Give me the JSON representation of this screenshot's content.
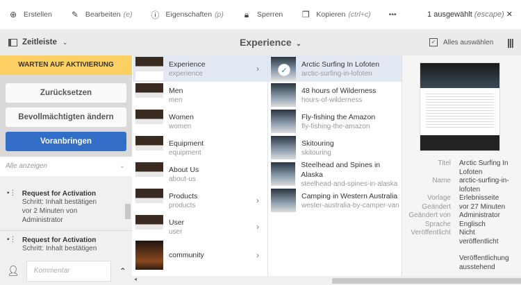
{
  "toolbar": {
    "create": "Erstellen",
    "edit": "Bearbeiten",
    "edit_key": "(e)",
    "props": "Eigenschaften",
    "props_key": "(p)",
    "lock": "Sperren",
    "copy": "Kopieren",
    "copy_key": "(ctrl+c)",
    "more": "•••",
    "selected": "1 ausgewählt",
    "selected_key": "(escape)",
    "close": "✕"
  },
  "header": {
    "rail": "Zeitleiste",
    "title": "Experience",
    "select_all": "Alles auswählen"
  },
  "left": {
    "banner": "WARTEN AUF AKTIVIERUNG",
    "btn_reset": "Zurücksetzen",
    "btn_delegate": "Bevollmächtigten ändern",
    "btn_advance": "Voranbringen",
    "filter": "Alle anzeigen",
    "items": [
      {
        "title": "Request for Activation",
        "step": "Schritt: Inhalt bestätigen",
        "time": "vor 2 Minuten von Administrator"
      },
      {
        "title": "Request for Activation",
        "step": "Schritt: Inhalt bestätigen"
      }
    ],
    "comment_placeholder": "Kommentar"
  },
  "col1": [
    {
      "title": "Experience",
      "name": "experience"
    },
    {
      "title": "Men",
      "name": "men"
    },
    {
      "title": "Women",
      "name": "women"
    },
    {
      "title": "Equipment",
      "name": "equipment"
    },
    {
      "title": "About Us",
      "name": "about-us"
    },
    {
      "title": "Products",
      "name": "products"
    },
    {
      "title": "User",
      "name": "user"
    },
    {
      "title": "community",
      "name": ""
    }
  ],
  "col2": [
    {
      "title": "Arctic Surfing In Lofoten",
      "name": "arctic-surfing-in-lofoten"
    },
    {
      "title": "48 hours of Wilderness",
      "name": "hours-of-wilderness"
    },
    {
      "title": "Fly-fishing the Amazon",
      "name": "fly-fishing-the-amazon"
    },
    {
      "title": "Skitouring",
      "name": "skitouring"
    },
    {
      "title": "Steelhead and Spines in Alaska",
      "name": "steelhead-and-spines-in-alaska"
    },
    {
      "title": "Camping in Western Australia",
      "name": "wester-australia-by-camper-van"
    }
  ],
  "meta": [
    {
      "k": "Titel",
      "v": "Arctic Surfing In Lofoten"
    },
    {
      "k": "Name",
      "v": "arctic-surfing-in-lofoten"
    },
    {
      "k": "Vorlage",
      "v": "Erlebnisseite"
    },
    {
      "k": "Geändert",
      "v": "vor 27 Minuten"
    },
    {
      "k": "Geändert von",
      "v": "Administrator"
    },
    {
      "k": "Sprache",
      "v": "Englisch"
    },
    {
      "k": "Veröffentlicht",
      "v": "Nicht veröffentlicht"
    },
    {
      "k": "",
      "v": "Veröffentlichung ausstehend"
    }
  ]
}
